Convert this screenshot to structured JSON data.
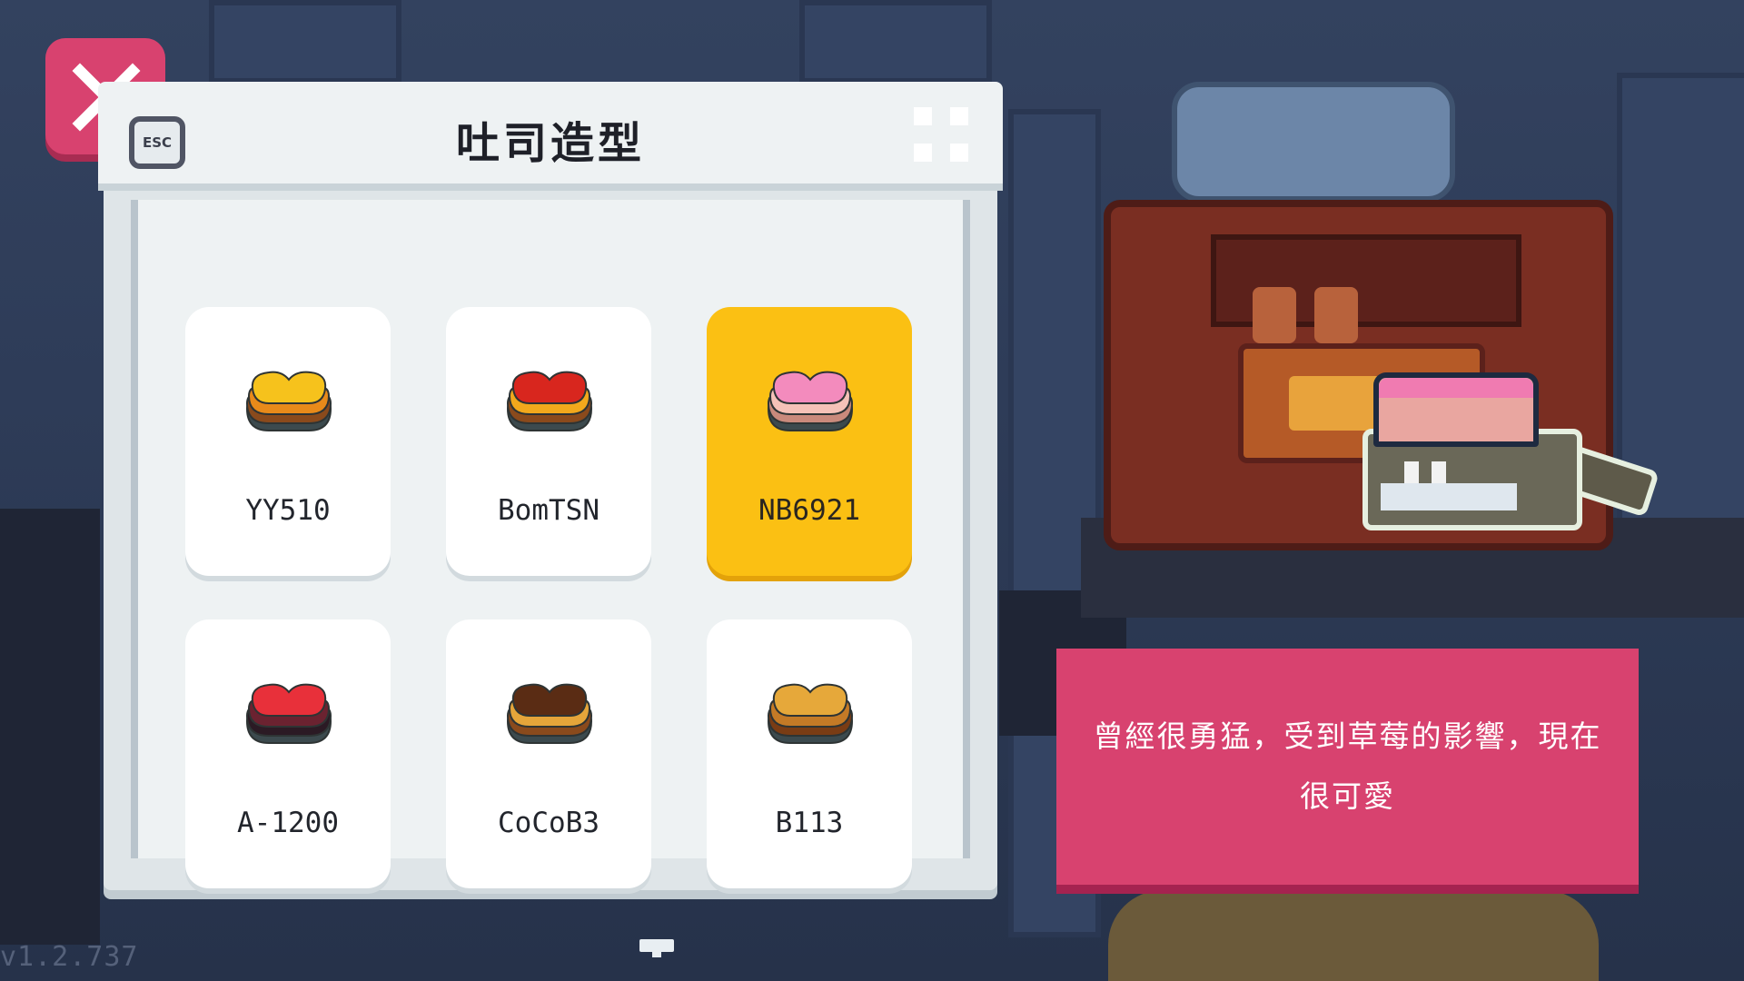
{
  "panel": {
    "title": "吐司造型"
  },
  "close": {
    "icon": "close-icon",
    "esc_label": "ESC"
  },
  "toasts": [
    {
      "name": "YY510",
      "top": "#f6c21c",
      "mid": "#e88a1a",
      "base": "#8a4a1c",
      "selected": false
    },
    {
      "name": "BomTSN",
      "top": "#d8261e",
      "mid": "#f2a81c",
      "base": "#8a4a1c",
      "selected": false
    },
    {
      "name": "NB6921",
      "top": "#f38bbd",
      "mid": "#f5c2b8",
      "base": "#c98a7c",
      "selected": true
    },
    {
      "name": "A-1200",
      "top": "#e8303a",
      "mid": "#6b2230",
      "base": "#2b1a24",
      "selected": false
    },
    {
      "name": "CoCoB3",
      "top": "#5a2c14",
      "mid": "#e5a53a",
      "base": "#8a4a1c",
      "selected": false
    },
    {
      "name": "B113",
      "top": "#e6a83a",
      "mid": "#c47a26",
      "base": "#7a3c14",
      "selected": false
    }
  ],
  "description": {
    "text": "曾經很勇猛，受到草莓的影響，現在很可愛"
  },
  "version": "v1.2.737",
  "colors": {
    "accent_pink": "#d8426f",
    "selected_yellow": "#fbc013",
    "panel_bg": "#eef2f3"
  }
}
